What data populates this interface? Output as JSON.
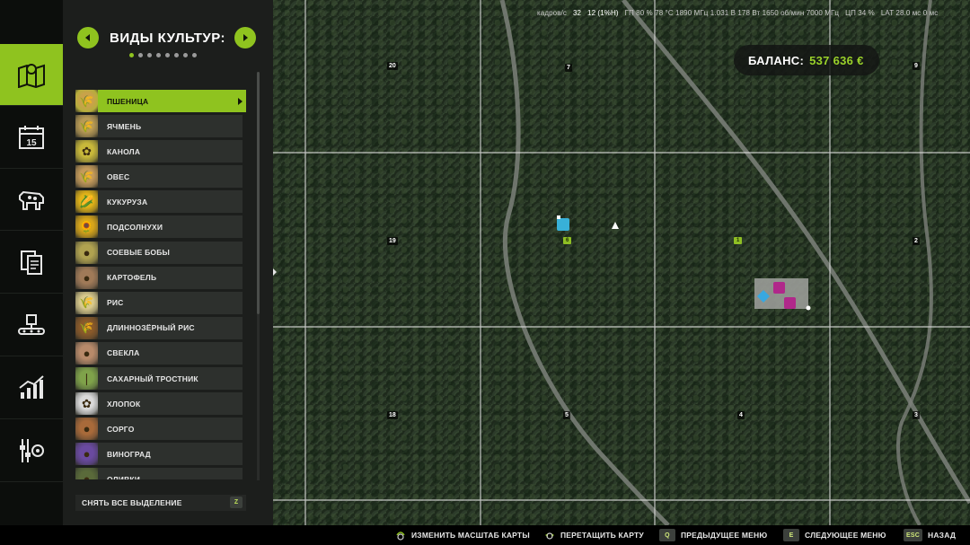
{
  "panel": {
    "title": "ВИДЫ КУЛЬТУР:",
    "page_count": 8,
    "page_index": 0,
    "crops": [
      {
        "label": "ПШЕНИЦА",
        "icon": "wheat-icon",
        "color": "#c9a24a",
        "glyph": "🌾",
        "selected": true
      },
      {
        "label": "ЯЧМЕНЬ",
        "icon": "barley-icon",
        "color": "#b89a55",
        "glyph": "🌾"
      },
      {
        "label": "КАНОЛА",
        "icon": "canola-icon",
        "color": "#c8b83a",
        "glyph": "✿"
      },
      {
        "label": "ОВЕС",
        "icon": "oat-icon",
        "color": "#c49a5a",
        "glyph": "🌾"
      },
      {
        "label": "КУКУРУЗА",
        "icon": "corn-icon",
        "color": "#e2b318",
        "glyph": "🌽"
      },
      {
        "label": "ПОДСОЛНУХИ",
        "icon": "sunflower-icon",
        "color": "#d7a51a",
        "glyph": "🌻"
      },
      {
        "label": "СОЕВЫЕ БОБЫ",
        "icon": "soybean-icon",
        "color": "#b0a250",
        "glyph": "●"
      },
      {
        "label": "КАРТОФЕЛЬ",
        "icon": "potato-icon",
        "color": "#a07a58",
        "glyph": "●"
      },
      {
        "label": "РИС",
        "icon": "rice-icon",
        "color": "#d8c98c",
        "glyph": "🌾"
      },
      {
        "label": "ДЛИННОЗЁРНЫЙ РИС",
        "icon": "long-grain-rice-icon",
        "color": "#8a5a2a",
        "glyph": "🌾"
      },
      {
        "label": "СВЕКЛА",
        "icon": "beet-icon",
        "color": "#b88a6a",
        "glyph": "●"
      },
      {
        "label": "САХАРНЫЙ ТРОСТНИК",
        "icon": "sugarcane-icon",
        "color": "#7fa24a",
        "glyph": "❘"
      },
      {
        "label": "ХЛОПОК",
        "icon": "cotton-icon",
        "color": "#d9d9d9",
        "glyph": "✿"
      },
      {
        "label": "СОРГО",
        "icon": "sorghum-icon",
        "color": "#a86a3a",
        "glyph": "●"
      },
      {
        "label": "ВИНОГРАД",
        "icon": "grape-icon",
        "color": "#6a4aa0",
        "glyph": "●"
      },
      {
        "label": "ОЛИВКИ",
        "icon": "olive-icon",
        "color": "#5a6a3a",
        "glyph": "●"
      }
    ],
    "deselect_label": "СНЯТЬ ВСЕ ВЫДЕЛЕНИЕ",
    "deselect_key": "Z"
  },
  "nav": [
    {
      "name": "map-icon",
      "active": true
    },
    {
      "name": "calendar-icon",
      "text": "15"
    },
    {
      "name": "animals-icon"
    },
    {
      "name": "contracts-icon"
    },
    {
      "name": "production-icon"
    },
    {
      "name": "statistics-icon"
    },
    {
      "name": "settings-icon"
    }
  ],
  "stats": {
    "fps_label": "кадров/с",
    "fps": "32",
    "frame": "12 (1%Н)",
    "gpu": "ГП  80 %  78 °C  1890 МГц  1.031 В  178 Вт  1650 об/мин  7000 МГц",
    "cpu": "ЦП  34 %",
    "lat": "LAT  28.0 мс  0 мс"
  },
  "balance": {
    "label": "БАЛАНС:",
    "value": "537 636 €"
  },
  "map": {
    "grid_labels": [
      {
        "text": "20"
      },
      {
        "text": "7"
      },
      {
        "text": "9"
      },
      {
        "text": "19"
      },
      {
        "text": "2"
      },
      {
        "text": "18"
      },
      {
        "text": "5"
      },
      {
        "text": "4"
      },
      {
        "text": "3"
      }
    ],
    "field_tags": [
      {
        "text": "6"
      },
      {
        "text": "1"
      }
    ]
  },
  "bottom": {
    "hints": [
      {
        "label": "ИЗМЕНИТЬ МАСШТАБ КАРТЫ",
        "key": ""
      },
      {
        "label": "ПЕРЕТАЩИТЬ КАРТУ",
        "key": ""
      },
      {
        "label": "ПРЕДЫДУЩЕЕ МЕНЮ",
        "key": "Q"
      },
      {
        "label": "СЛЕДУЮЩЕЕ МЕНЮ",
        "key": "E"
      },
      {
        "label": "НАЗАД",
        "key": "ESC"
      }
    ]
  },
  "colors": {
    "accent": "#8fc31f",
    "panel": "#1c1e1c",
    "balance_value": "#9ad22a"
  }
}
